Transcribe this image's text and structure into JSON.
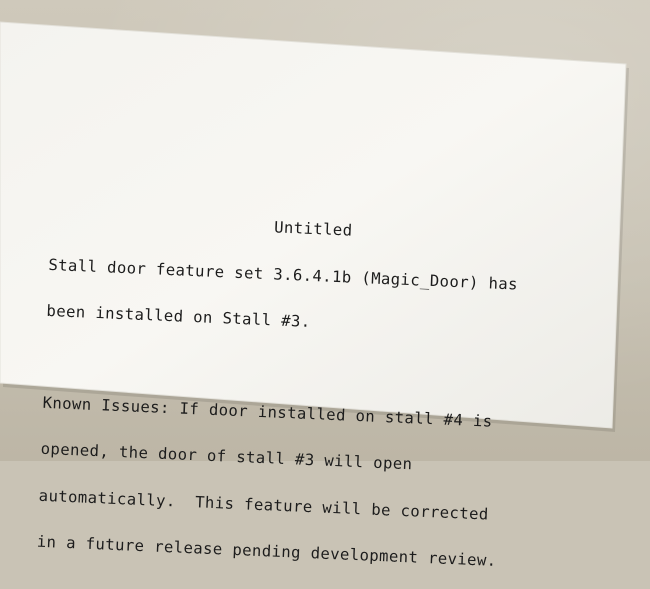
{
  "receipt": {
    "title": "Untitled",
    "body_lines": [
      "Stall door feature set 3.6.4.1b (Magic_Door) has",
      "been installed on Stall #3."
    ],
    "issues_lines": [
      "Known Issues: If door installed on stall #4 is",
      "opened, the door of stall #3 will open",
      "automatically.  This feature will be corrected",
      "in a future release pending development review."
    ]
  },
  "colors": {
    "paper": "#f7f6f2",
    "ink": "#1c1c1c",
    "wall": "#c9c3b5"
  }
}
